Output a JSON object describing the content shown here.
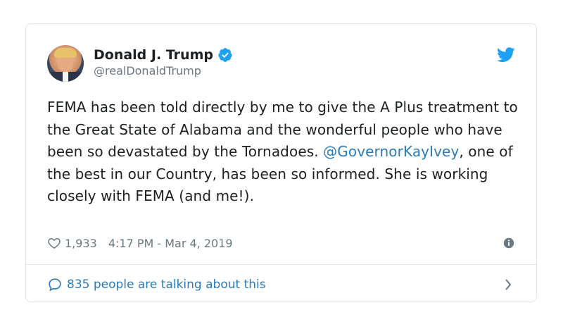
{
  "author": {
    "display_name": "Donald J. Trump",
    "handle": "@realDonaldTrump",
    "verified": true
  },
  "tweet": {
    "text_before": "FEMA has been told directly by me to give the A Plus treatment to the Great State of Alabama and the wonderful people who have been so devastated by the Tornadoes. ",
    "mention": "@GovernorKayIvey",
    "text_after": ", one of the best in our Country, has been so informed. She is working closely with FEMA (and me!)."
  },
  "meta": {
    "like_count": "1,933",
    "timestamp": "4:17 PM - Mar 4, 2019"
  },
  "footer": {
    "talking_label": "835 people are talking about this"
  },
  "colors": {
    "link_blue": "#2b7bb9",
    "verified_blue": "#1da1f2",
    "meta_gray": "#697882",
    "border": "#e1e8ed"
  },
  "icons": {
    "brand": "twitter-bird-icon",
    "verified": "verified-badge-icon",
    "like": "heart-icon",
    "info": "info-icon",
    "reply": "speech-bubble-icon",
    "chevron": "chevron-right-icon"
  }
}
